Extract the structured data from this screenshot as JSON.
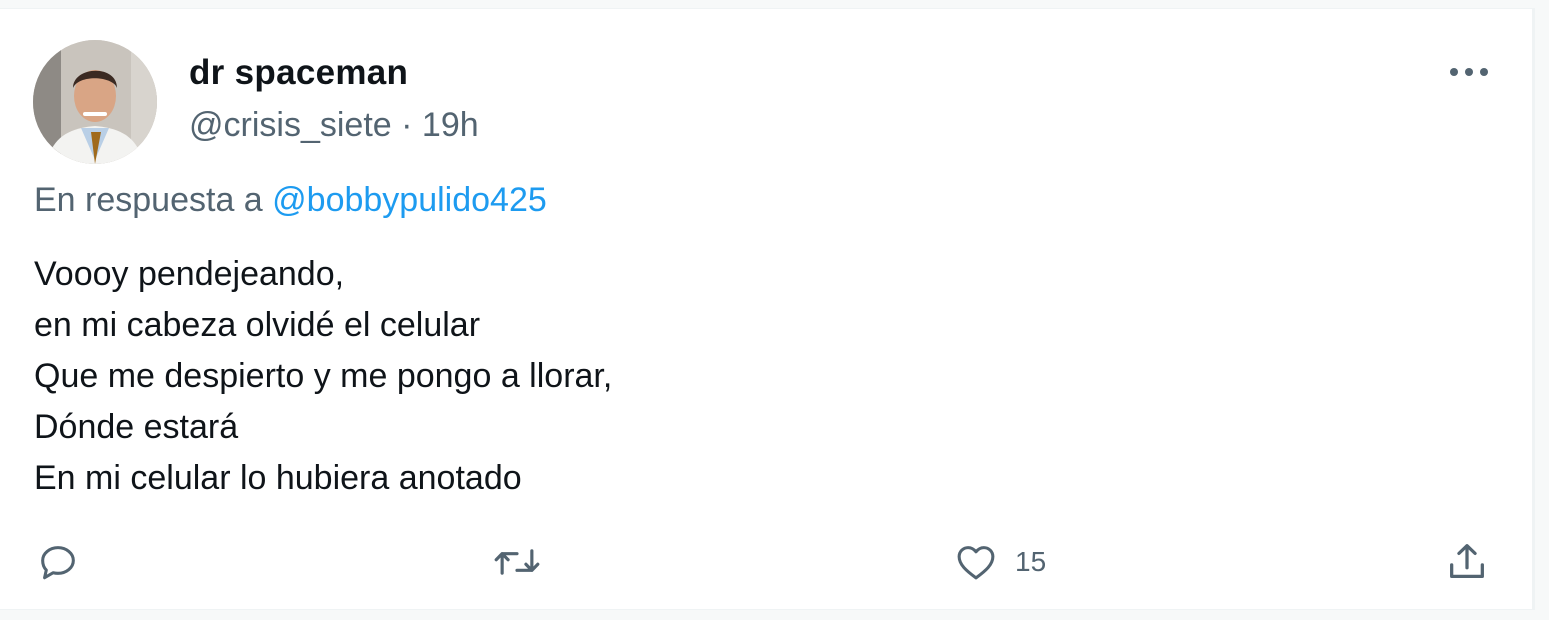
{
  "tweet": {
    "display_name": "dr spaceman",
    "handle": "@crisis_siete",
    "separator": "·",
    "time": "19h",
    "reply_prefix": "En respuesta a",
    "reply_handle": "@bobbypulido425",
    "lines": [
      "Voooy pendejeando,",
      "en mi cabeza olvidé el celular",
      "Que me despierto y me pongo a llorar,",
      "Dónde estará",
      "En mi celular lo hubiera anotado"
    ]
  },
  "actions": {
    "reply_icon": "reply-icon",
    "retweet_icon": "retweet-icon",
    "like_icon": "heart-icon",
    "like_count": "15",
    "share_icon": "share-icon"
  },
  "colors": {
    "text": "#0f1419",
    "secondary": "#536471",
    "link": "#1d9bf0",
    "border": "#eff3f4"
  }
}
